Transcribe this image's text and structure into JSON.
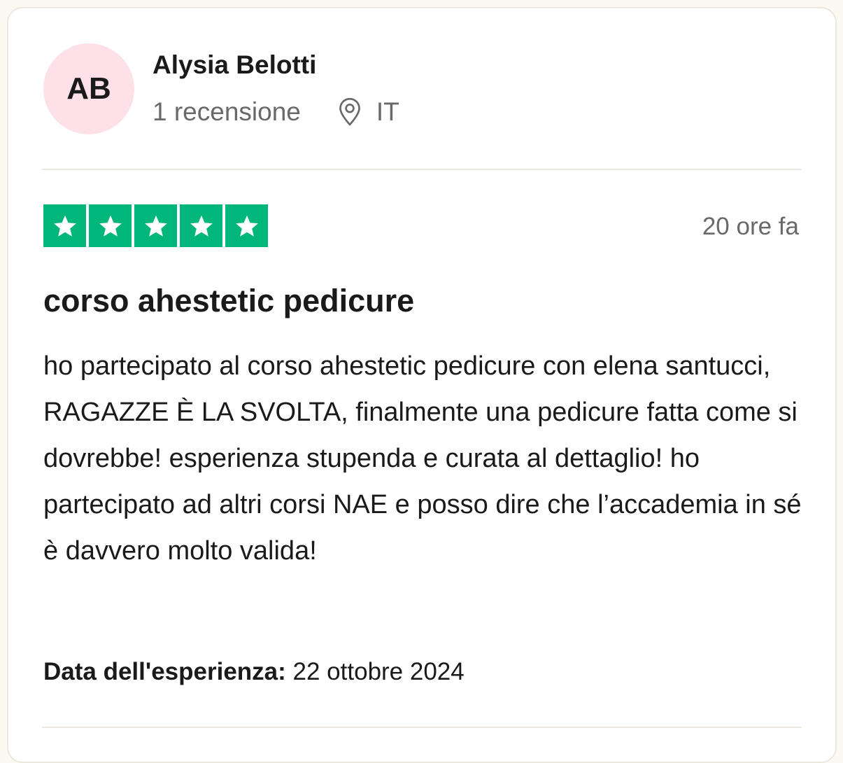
{
  "review": {
    "consumer": {
      "initials": "AB",
      "name": "Alysia Belotti",
      "review_count": "1 recensione",
      "country": "IT",
      "avatar_color": "#fde0e8"
    },
    "rating": {
      "stars": 5,
      "max_stars": 5,
      "star_color": "#00b67a"
    },
    "time_ago": "20 ore fa",
    "title": "corso ahestetic pedicure",
    "body": "ho partecipato al corso ahestetic pedicure con elena santucci, RAGAZZE È LA SVOLTA, finalmente una pedicure fatta come si dovrebbe! esperienza stupenda e curata al dettaglio! ho partecipato ad altri corsi NAE e posso dire che l’accademia in sé è davvero molto valida!",
    "experience_label": "Data dell'esperienza:",
    "experience_date": "22 ottobre 2024"
  },
  "icons": {
    "location": "location-pin-icon",
    "star": "star-icon"
  }
}
